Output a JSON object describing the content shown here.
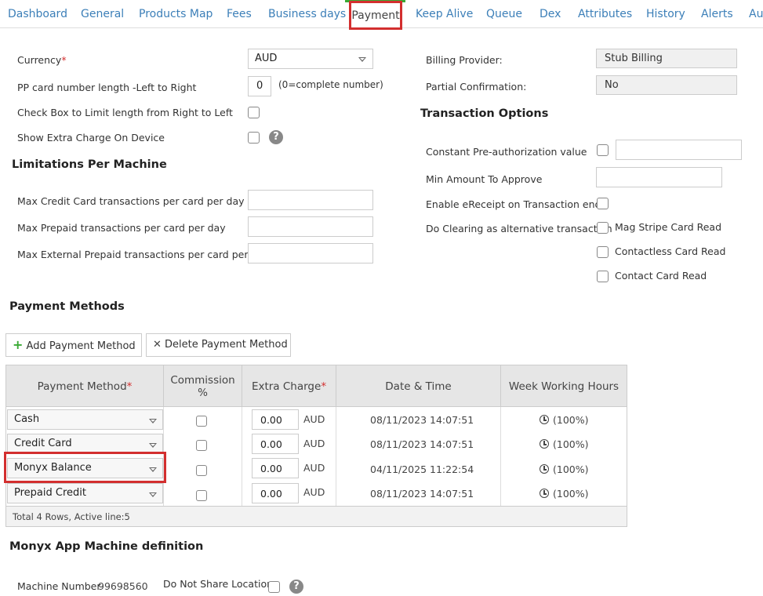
{
  "tabs": [
    "Dashboard",
    "General",
    "Products Map",
    "Fees",
    "Business days",
    "Payment",
    "Keep Alive",
    "Queue",
    "Dex",
    "Attributes",
    "History",
    "Alerts",
    "Au"
  ],
  "active_tab": "Payment",
  "left": {
    "currency_label": "Currency",
    "currency_value": "AUD",
    "pp_length_label": "PP card number length -Left to Right",
    "pp_length_value": "0",
    "pp_length_hint": "(0=complete number)",
    "limit_rtl_label": "Check Box to Limit length from Right to Left",
    "extra_charge_label": "Show Extra Charge On Device",
    "limitations_heading": "Limitations Per Machine",
    "max_credit_label": "Max Credit Card transactions per card per day",
    "max_prepaid_label": "Max Prepaid transactions per card per day",
    "max_ext_prepaid_label": "Max External Prepaid transactions per card per day"
  },
  "right": {
    "billing_provider_label": "Billing Provider:",
    "billing_provider_value": "Stub Billing",
    "partial_conf_label": "Partial Confirmation:",
    "partial_conf_value": "No",
    "transaction_heading": "Transaction Options",
    "preauth_label": "Constant Pre-authorization value",
    "min_amount_label": "Min Amount To Approve",
    "ereceipt_label": "Enable eReceipt on Transaction end",
    "clearing_label": "Do Clearing as alternative transaction",
    "clearing_options": [
      "Mag Stripe Card Read",
      "Contactless Card Read",
      "Contact Card Read"
    ]
  },
  "payment_methods": {
    "heading": "Payment Methods",
    "add_label": "Add Payment Method",
    "delete_label": "Delete Payment Method",
    "columns": {
      "method": "Payment Method",
      "commission": "Commission %",
      "extra": "Extra Charge",
      "date": "Date & Time",
      "hours": "Week Working Hours"
    },
    "rows": [
      {
        "method": "Cash",
        "extra": "0.00",
        "currency": "AUD",
        "date": "08/11/2023 14:07:51",
        "hours": "(100%)"
      },
      {
        "method": "Credit Card",
        "extra": "0.00",
        "currency": "AUD",
        "date": "08/11/2023 14:07:51",
        "hours": "(100%)"
      },
      {
        "method": "Monyx Balance",
        "extra": "0.00",
        "currency": "AUD",
        "date": "04/11/2025 11:22:54",
        "hours": "(100%)"
      },
      {
        "method": "Prepaid Credit",
        "extra": "0.00",
        "currency": "AUD",
        "date": "08/11/2023 14:07:51",
        "hours": "(100%)"
      }
    ],
    "footer": "Total 4 Rows, Active line:5"
  },
  "monyx": {
    "heading": "Monyx App Machine definition",
    "machine_number_label": "Machine Number",
    "machine_number_value": "99698560",
    "share_location_label": "Do Not Share Location"
  },
  "icons": {
    "add": "plus-icon",
    "delete": "x-icon",
    "help": "question-icon",
    "dropdown": "caret-down-icon",
    "hours": "clock-icon"
  },
  "colors": {
    "link": "#3c7fb8",
    "highlight": "#d32f2f",
    "active_tab_top": "#3aaa35",
    "add_icon": "#3aaa35"
  }
}
